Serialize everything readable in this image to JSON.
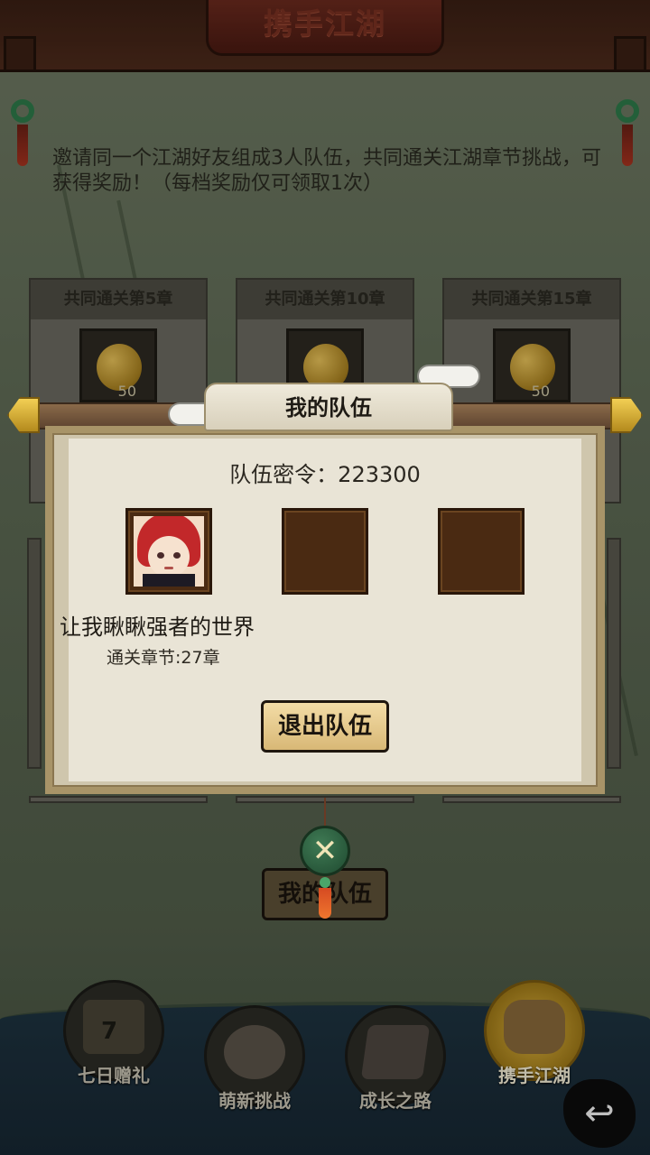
{
  "header": {
    "title": "携手江湖"
  },
  "intro_text": "邀请同一个江湖好友组成3人队伍，共同通关江湖章节挑战，可获得奖励！（每档奖励仅可领取1次）",
  "reward_cards": [
    {
      "title": "共同通关第5章",
      "item_icon": "gold-gourd-icon",
      "count": "50"
    },
    {
      "title": "共同通关第10章",
      "item_icon": "gold-gourd-icon",
      "count": ""
    },
    {
      "title": "共同通关第15章",
      "item_icon": "gold-gourd-icon",
      "count": "50"
    }
  ],
  "team_modal": {
    "title": "我的队伍",
    "password_label": "队伍密令：223300",
    "members": [
      {
        "name": "让我瞅瞅强者的世界",
        "chapter": "通关章节:27章",
        "has_avatar": true
      },
      {
        "name": "",
        "chapter": "",
        "has_avatar": false
      },
      {
        "name": "",
        "chapter": "",
        "has_avatar": false
      }
    ],
    "leave_button": "退出队伍",
    "close_icon": "close-x-icon"
  },
  "my_team_button": "我的队伍",
  "bottom_nav": [
    {
      "label": "七日赠礼",
      "icon": "gift-box-icon",
      "badge": "7",
      "active": false
    },
    {
      "label": "萌新挑战",
      "icon": "cute-face-icon",
      "active": false
    },
    {
      "label": "成长之路",
      "icon": "book-arrow-icon",
      "active": false
    },
    {
      "label": "携手江湖",
      "icon": "handshake-icon",
      "active": true
    }
  ],
  "back_icon": "back-arrow-icon",
  "colors": {
    "header_bg": "#4d2a1b",
    "modal_bg": "#e9e4d6",
    "button_gold": "#f3dca6",
    "close_green": "#2f6a44",
    "slot_brown": "#4a2a12"
  }
}
